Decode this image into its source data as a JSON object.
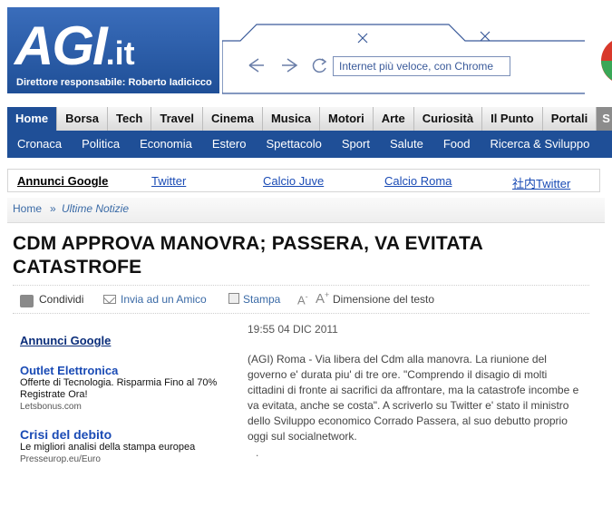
{
  "header": {
    "logo": "AGI",
    "logo_suffix": ".it",
    "director": "Direttore responsabile: Roberto Iadicicco",
    "ad_url": "Internet più veloce, con Chrome"
  },
  "nav_primary": [
    "Home",
    "Borsa",
    "Tech",
    "Travel",
    "Cinema",
    "Musica",
    "Motori",
    "Arte",
    "Curiosità",
    "Il Punto",
    "Portali",
    "S"
  ],
  "nav_secondary": [
    "Cronaca",
    "Politica",
    "Economia",
    "Estero",
    "Spettacolo",
    "Sport",
    "Salute",
    "Food",
    "Ricerca & Sviluppo"
  ],
  "ad_bar": {
    "label": "Annunci Google",
    "links": [
      "Twitter",
      "Calcio Juve",
      "Calcio Roma",
      "社内Twitter"
    ]
  },
  "breadcrumb": {
    "home": "Home",
    "sep": "»",
    "current": "Ultime Notizie"
  },
  "article": {
    "title": "CDM APPROVA MANOVRA; PASSERA, VA EVITATA CATASTROFE",
    "date": "19:55 04 DIC 2011",
    "body": "(AGI) Roma - Via libera del Cdm alla manovra. La riunione del governo e' durata piu' di tre ore. \"Comprendo il disagio di molti cittadini di fronte ai sacrifici da affrontare, ma la catastrofe incombe e va evitata, anche se costa\". A scriverlo su Twitter e' stato il ministro dello Sviluppo economico Corrado Passera, al suo debutto proprio oggi sul socialnetwork.",
    "trail": "."
  },
  "tools": {
    "share": "Condividi",
    "send": "Invia ad un Amico",
    "print": "Stampa",
    "font_small": "A",
    "font_sep": "-",
    "font_large": "A",
    "font_plus": "+",
    "font_label": "Dimensione del testo"
  },
  "sidebar": {
    "header": "Annunci Google",
    "ads": [
      {
        "title": "Outlet Elettronica",
        "desc": "Offerte di Tecnologia. Risparmia Fino al 70% Registrate Ora!",
        "url": "Letsbonus.com"
      },
      {
        "title": "Crisi del debito",
        "desc": "Le migliori analisi della stampa europea",
        "url": "Presseurop.eu/Euro"
      }
    ]
  },
  "colors": {
    "brand_blue": "#1f4f97",
    "link_blue": "#1a4bb5"
  }
}
